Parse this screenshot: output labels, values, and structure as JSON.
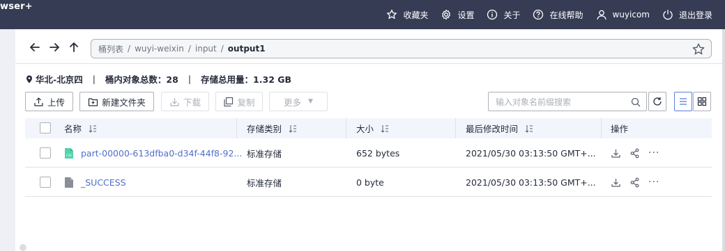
{
  "app": {
    "brand": "wser+"
  },
  "topnav": {
    "favorites": "收藏夹",
    "settings": "设置",
    "about": "关于",
    "help": "在线帮助",
    "user": "wuyicom",
    "logout": "退出登录"
  },
  "path": {
    "segments": [
      "桶列表",
      "wuyi-weixin",
      "input"
    ],
    "separator": "/",
    "current": "output1"
  },
  "info": {
    "region": "华北-北京四",
    "divider": "|",
    "object_count": "桶内对象总数：28",
    "storage_used": "存储总用量：1.32 GB"
  },
  "toolbar": {
    "upload": "上传",
    "new_folder": "新建文件夹",
    "download": "下载",
    "copy": "复制",
    "more": "更多"
  },
  "search": {
    "placeholder": "输入对象名前缀搜索"
  },
  "table": {
    "columns": [
      "名称",
      "存储类别",
      "大小",
      "最后修改时间",
      "操作"
    ],
    "rows": [
      {
        "name": "part-00000-613dfba0-d34f-44f8-92...",
        "storage_class": "标准存储",
        "size": "652 bytes",
        "modified": "2021/05/30 03:13:50 GMT+...",
        "icon": "csv-file-icon",
        "more": "···"
      },
      {
        "name": "_SUCCESS",
        "storage_class": "标准存储",
        "size": "0 byte",
        "modified": "2021/05/30 03:13:50 GMT+...",
        "icon": "file-icon",
        "more": "···"
      }
    ]
  },
  "colors": {
    "topbar": "#363c54",
    "link": "#526ecc",
    "header_bg": "#f2f5fc",
    "csv_green": "#50d4ab",
    "active_view": "#5e7ce0"
  }
}
